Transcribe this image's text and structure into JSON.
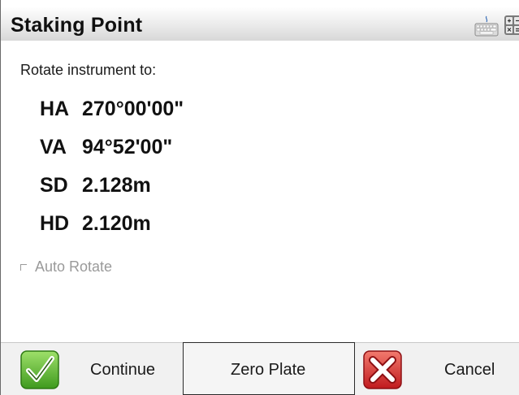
{
  "window": {
    "title": "Staking Point",
    "icons": [
      "keyboard-icon",
      "calculator-icon"
    ]
  },
  "content": {
    "prompt": "Rotate instrument to:",
    "readings": [
      {
        "label": "HA",
        "value": "270°00'00\""
      },
      {
        "label": "VA",
        "value": "94°52'00\""
      },
      {
        "label": "SD",
        "value": "2.128m"
      },
      {
        "label": "HD",
        "value": "2.120m"
      }
    ],
    "auto_rotate": {
      "label": "Auto Rotate",
      "checked": false,
      "enabled": false
    }
  },
  "buttons": {
    "continue_label": "Continue",
    "zero_plate_label": "Zero Plate",
    "cancel_label": "Cancel",
    "continue_icon": "green-check-icon",
    "cancel_icon": "red-x-icon"
  },
  "colors": {
    "confirm_green": "#5cb82e",
    "cancel_red": "#d8262a",
    "disabled_text": "#9a9a9a"
  }
}
